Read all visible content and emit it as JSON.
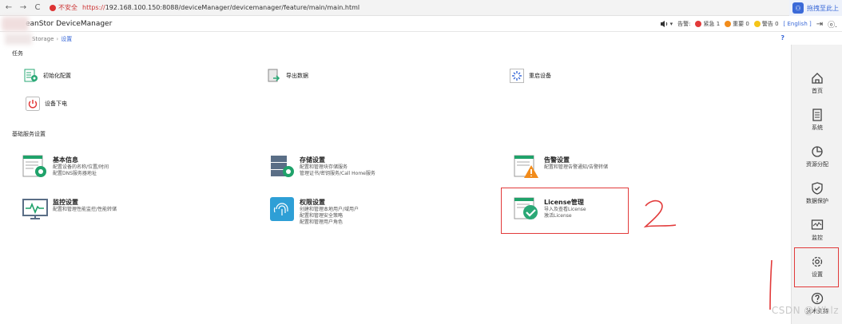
{
  "browser": {
    "insecure_label": "不安全",
    "url_protocol": "https://",
    "url_rest": "192.168.100.150:8088/deviceManager/devicemanager/feature/main/main.html",
    "extension_label": "拖拽至此上"
  },
  "header": {
    "app_title": "eanStor DeviceManager",
    "alarm_label": "告警:",
    "critical": "紧急 1",
    "major": "重要 0",
    "warning": "警告 0",
    "language": "[ English ]"
  },
  "breadcrumb": {
    "parent": "Storage",
    "current": "设置",
    "help": "?"
  },
  "tasks": {
    "section_title": "任务",
    "items": [
      {
        "label": "初始化配置"
      },
      {
        "label": "导出数据"
      },
      {
        "label": "重启设备"
      },
      {
        "label": "设备下电"
      }
    ]
  },
  "basic": {
    "section_title": "基础服务设置",
    "cards": [
      {
        "title": "基本信息",
        "lines": [
          "配置设备的名称/位置/时间",
          "配置DNS服务器地址"
        ]
      },
      {
        "title": "存储设置",
        "lines": [
          "配置和管理块存储服务",
          "管理证书/密钥服务/Call Home服务"
        ]
      },
      {
        "title": "告警设置",
        "lines": [
          "配置和管理告警通知/告警转储"
        ]
      },
      {
        "title": "监控设置",
        "lines": [
          "配置和管理性能监控/性能转储"
        ]
      },
      {
        "title": "权限设置",
        "lines": [
          "创建和管理本地用户/域用户",
          "配置和管理安全策略",
          "配置和管理用户角色"
        ]
      },
      {
        "title": "License管理",
        "lines": [
          "导入及查看License",
          "激活License"
        ]
      }
    ]
  },
  "sidebar": {
    "items": [
      {
        "label": "首页",
        "icon": "home-icon"
      },
      {
        "label": "系统",
        "icon": "system-icon"
      },
      {
        "label": "资源分配",
        "icon": "resource-icon"
      },
      {
        "label": "数据保护",
        "icon": "shield-icon"
      },
      {
        "label": "监控",
        "icon": "monitor-icon"
      },
      {
        "label": "设置",
        "icon": "gear-icon"
      },
      {
        "label": "技术支持",
        "icon": "help-icon"
      }
    ]
  },
  "watermark": "CSDN @Whlz",
  "colors": {
    "accent": "#3b6ad8",
    "green": "#1fa26a",
    "red_annotation": "#e23a3a"
  }
}
